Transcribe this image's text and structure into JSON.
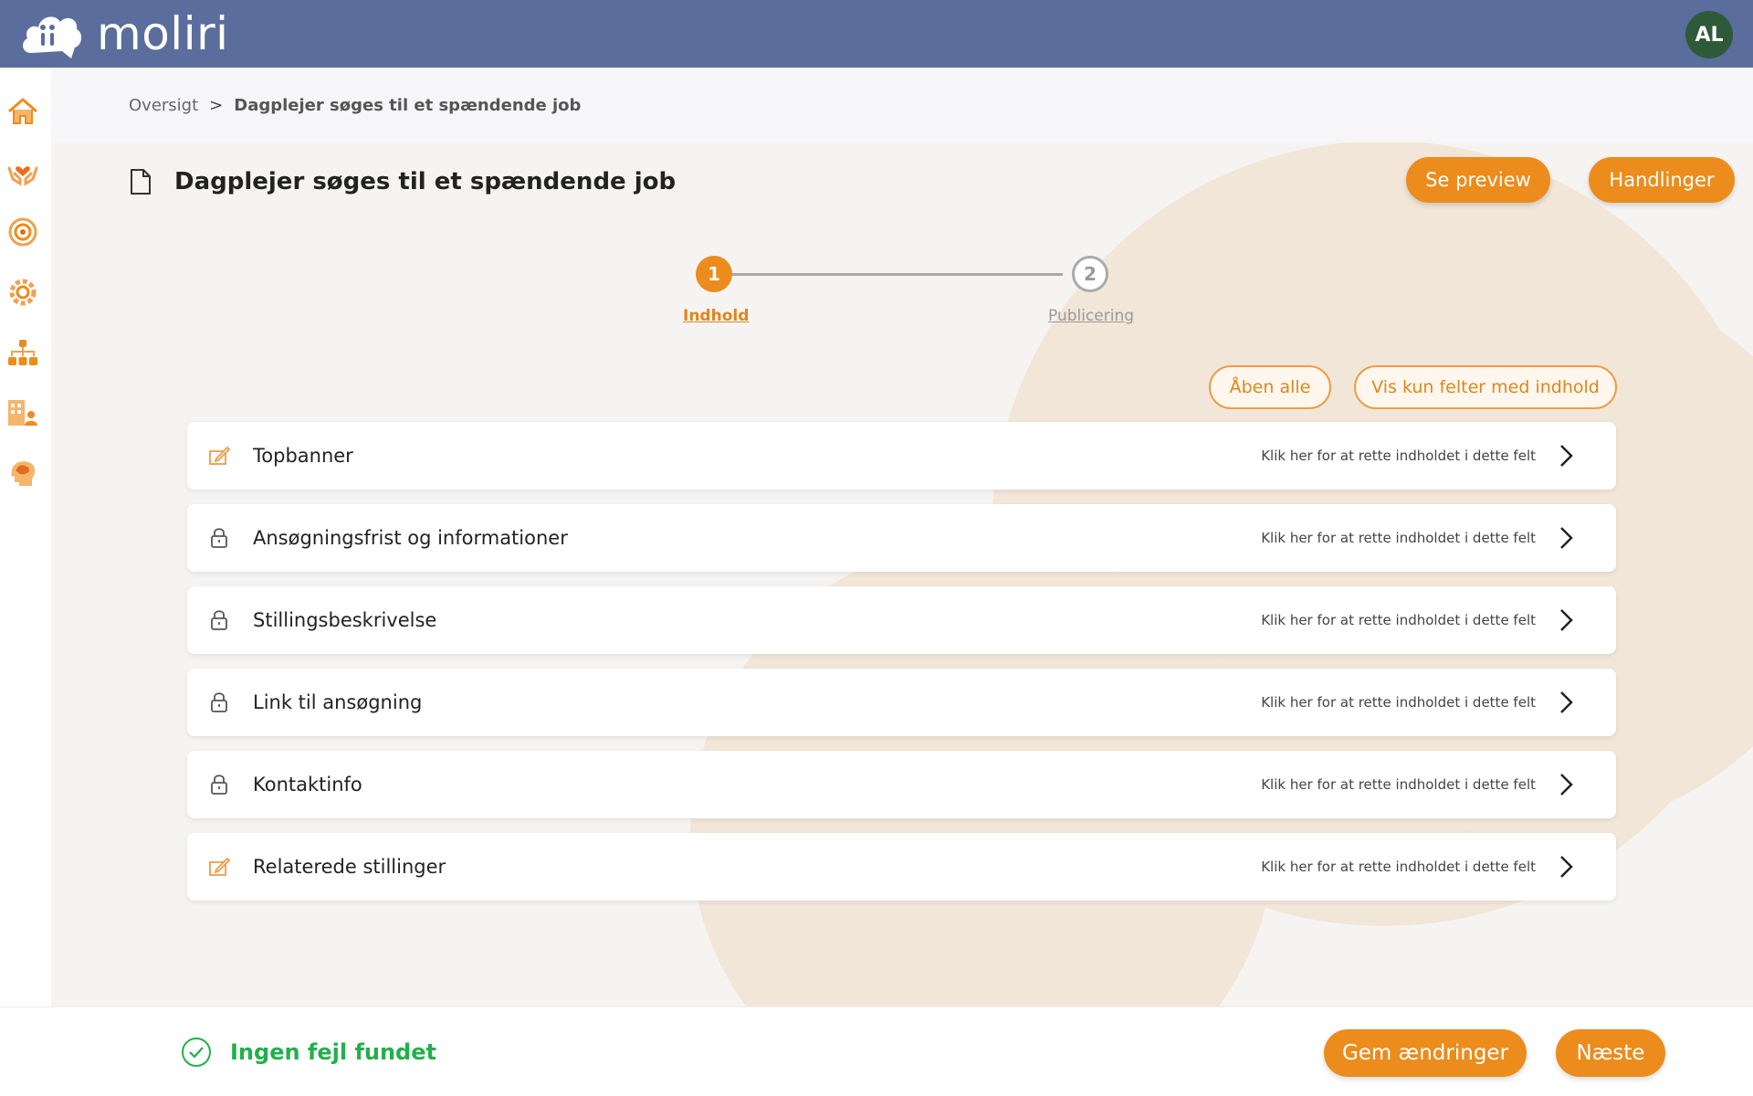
{
  "app": {
    "name": "moliri",
    "user_initials": "AL"
  },
  "colors": {
    "accent": "#ec8c1c",
    "header": "#5b6d9c",
    "success": "#22b04a",
    "avatar": "#2f5a3a"
  },
  "sidebar": {
    "items": [
      {
        "icon": "home-icon"
      },
      {
        "icon": "heart-hands-icon"
      },
      {
        "icon": "target-icon"
      },
      {
        "icon": "gear-flower-icon"
      },
      {
        "icon": "org-chart-icon"
      },
      {
        "icon": "building-person-icon"
      },
      {
        "icon": "head-brain-icon"
      }
    ]
  },
  "breadcrumb": {
    "root": "Oversigt",
    "separator": ">",
    "current": "Dagplejer søges til et spændende job"
  },
  "page": {
    "title": "Dagplejer søges til et spændende job",
    "preview_label": "Se preview",
    "actions_label": "Handlinger"
  },
  "stepper": {
    "steps": [
      {
        "number": "1",
        "label": "Indhold",
        "active": true
      },
      {
        "number": "2",
        "label": "Publicering",
        "active": false
      }
    ]
  },
  "filters": {
    "open_all_label": "Åben alle",
    "show_content_only_label": "Vis kun felter med indhold"
  },
  "sections": [
    {
      "title": "Topbanner",
      "icon": "edit-icon",
      "hint": "Klik her for at rette indholdet i dette felt"
    },
    {
      "title": "Ansøgningsfrist og informationer",
      "icon": "lock-icon",
      "hint": "Klik her for at rette indholdet i dette felt"
    },
    {
      "title": "Stillingsbeskrivelse",
      "icon": "lock-icon",
      "hint": "Klik her for at rette indholdet i dette felt"
    },
    {
      "title": "Link til ansøgning",
      "icon": "lock-icon",
      "hint": "Klik her for at rette indholdet i dette felt"
    },
    {
      "title": "Kontaktinfo",
      "icon": "lock-icon",
      "hint": "Klik her for at rette indholdet i dette felt"
    },
    {
      "title": "Relaterede stillinger",
      "icon": "edit-icon",
      "hint": "Klik her for at rette indholdet i dette felt"
    }
  ],
  "footer": {
    "status": "Ingen fejl fundet",
    "save_label": "Gem ændringer",
    "next_label": "Næste"
  }
}
